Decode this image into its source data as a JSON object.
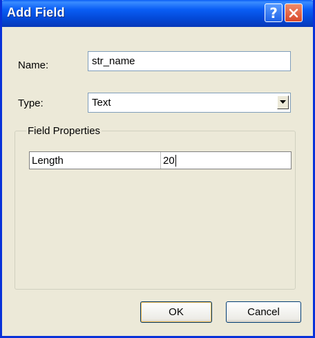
{
  "dialog": {
    "title": "Add Field",
    "help_label": "?",
    "name_label": "Name:",
    "name_value": "str_name",
    "type_label": "Type:",
    "type_value": "Text",
    "group_title": "Field Properties",
    "properties": [
      {
        "name": "Length",
        "value": "20"
      }
    ],
    "ok_label": "OK",
    "cancel_label": "Cancel"
  },
  "icons": {
    "help": "question-mark-icon",
    "close": "close-x-icon",
    "dropdown": "chevron-down-icon"
  },
  "colors": {
    "titlebar": "#0a5ef5",
    "close_button": "#d8482a",
    "dialog_background": "#ece9d8",
    "default_button_highlight": "#f0b848"
  }
}
